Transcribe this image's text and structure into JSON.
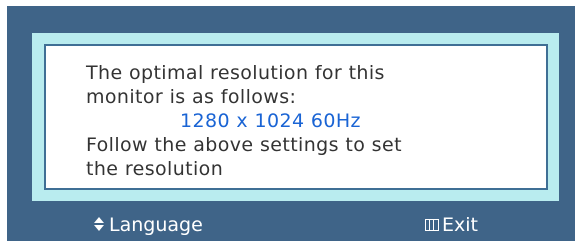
{
  "osd": {
    "message_lines": [
      "The optimal resolution for this",
      "monitor is as follows:"
    ],
    "resolution": "1280 x 1024 60Hz",
    "instruction_lines": [
      "Follow the above settings to set",
      "the resolution"
    ]
  },
  "footer": {
    "language_icon": "up-down-arrows-icon",
    "language_label": "Language",
    "exit_icon": "menu-icon",
    "exit_label": "Exit"
  },
  "colors": {
    "frame": "#3f6488",
    "panel_border": "#b9ecef",
    "inner_border": "#3f6f95",
    "resolution_text": "#1a64d4",
    "body_text": "#333333"
  }
}
